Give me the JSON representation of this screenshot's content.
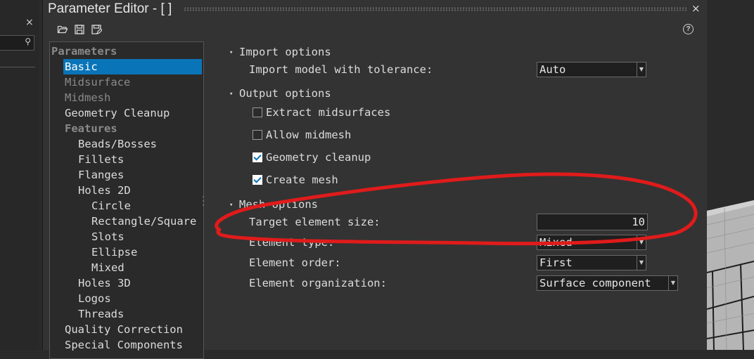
{
  "window": {
    "title": "Parameter Editor - [ ]",
    "close_glyph": "×",
    "help_glyph": "?"
  },
  "left_panel": {
    "close_glyph": "×",
    "search_glyph": "⚲"
  },
  "toolbar": {
    "icons": [
      "folder-open-icon",
      "save-icon",
      "save-as-icon"
    ]
  },
  "tree": {
    "items": [
      {
        "label": "Parameters",
        "style": "header",
        "indent": 0
      },
      {
        "label": "Basic",
        "style": "selected",
        "indent": 1
      },
      {
        "label": "Midsurface",
        "style": "disabled",
        "indent": 1
      },
      {
        "label": "Midmesh",
        "style": "disabled",
        "indent": 1
      },
      {
        "label": "Geometry Cleanup",
        "style": "normal",
        "indent": 1
      },
      {
        "label": "Features",
        "style": "header",
        "indent": 1
      },
      {
        "label": "Beads/Bosses",
        "style": "normal",
        "indent": 2
      },
      {
        "label": "Fillets",
        "style": "normal",
        "indent": 2
      },
      {
        "label": "Flanges",
        "style": "normal",
        "indent": 2
      },
      {
        "label": "Holes 2D",
        "style": "normal",
        "indent": 2
      },
      {
        "label": "Circle",
        "style": "normal",
        "indent": 3
      },
      {
        "label": "Rectangle/Square",
        "style": "normal",
        "indent": 3
      },
      {
        "label": "Slots",
        "style": "normal",
        "indent": 3
      },
      {
        "label": "Ellipse",
        "style": "normal",
        "indent": 3
      },
      {
        "label": "Mixed",
        "style": "normal",
        "indent": 3
      },
      {
        "label": "Holes 3D",
        "style": "normal",
        "indent": 2
      },
      {
        "label": "Logos",
        "style": "normal",
        "indent": 2
      },
      {
        "label": "Threads",
        "style": "normal",
        "indent": 2
      },
      {
        "label": "Quality Correction",
        "style": "normal",
        "indent": 1
      },
      {
        "label": "Special Components",
        "style": "normal",
        "indent": 1
      }
    ]
  },
  "import_options": {
    "title": "Import options",
    "tolerance_label": "Import model with tolerance:",
    "tolerance_value": "Auto"
  },
  "output_options": {
    "title": "Output options",
    "checkboxes": [
      {
        "label": "Extract midsurfaces",
        "checked": false
      },
      {
        "label": "Allow midmesh",
        "checked": false
      },
      {
        "label": "Geometry cleanup",
        "checked": true
      },
      {
        "label": "Create mesh",
        "checked": true
      }
    ]
  },
  "mesh_options": {
    "title": "Mesh options",
    "target_size_label": "Target element size:",
    "target_size_value": "10",
    "element_type_label": "Element type:",
    "element_type_value": "Mixed",
    "element_order_label": "Element order:",
    "element_order_value": "First",
    "element_org_label": "Element organization:",
    "element_org_value": "Surface component"
  },
  "annotation": {
    "color": "#e01b1b",
    "shape": "hand-drawn ellipse around Target element size"
  },
  "colors": {
    "accent": "#0a74b8",
    "background": "#333333"
  }
}
